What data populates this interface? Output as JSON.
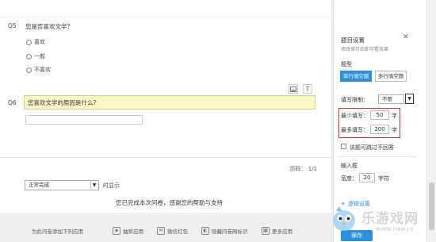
{
  "survey": {
    "q5": {
      "number": "Q5",
      "title": "您是否喜欢文学？",
      "options": [
        "喜欢",
        "一般",
        "不喜欢"
      ]
    },
    "q6": {
      "number": "Q6",
      "title": "您喜欢文学的原因是什么？",
      "tool_text_glyph": "T"
    },
    "pager": "页码： 1/1",
    "end_action": "正常完成",
    "timing_label": "时显示",
    "thanks": "您已完成本次问卷，感谢您的帮助与支持"
  },
  "bottom_bar": {
    "intro": "为此问卷添加下列应用",
    "items": [
      {
        "label": "抽奖应用",
        "icon": "gift-icon"
      },
      {
        "label": "微信红包",
        "icon": "red-envelope-icon"
      },
      {
        "label": "隐藏问卷网标识",
        "icon": "hide-icon"
      },
      {
        "label": "更多应用",
        "icon": "grid-icon"
      }
    ]
  },
  "panel": {
    "title": "题目设置",
    "subtitle": "修改保存后即可看效果",
    "close_glyph": "✕",
    "type_label": "题型",
    "type_options": [
      "单行填空题",
      "多行填空题"
    ],
    "active_type_index": 0,
    "limit_label": "填写限制：",
    "limit_value": "不限",
    "min_label": "最少填写：",
    "min_value": "50",
    "min_unit": "字",
    "max_label": "最多填写：",
    "max_value": "200",
    "max_unit": "字",
    "skip_label": "该题可跳过不回答",
    "input_box_label": "输入框",
    "width_label": "宽度：",
    "width_value": "20",
    "width_unit": "字符",
    "logic_label": "逻辑设置",
    "save_label": "保存"
  },
  "watermark": {
    "text": "乐游戏网",
    "url": "www.newyx"
  },
  "colors": {
    "accent": "#2b8fe0",
    "highlight": "#fbf6c6",
    "red_box": "#d53030"
  }
}
